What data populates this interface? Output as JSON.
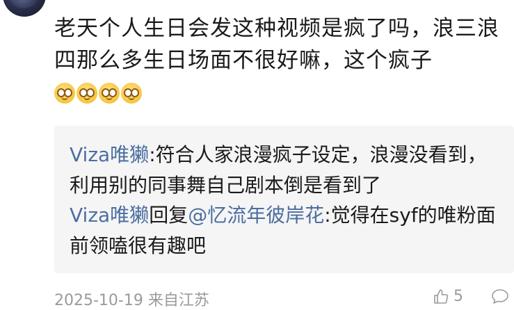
{
  "comment": {
    "line_text": "老天个人生日会发这种视频是疯了吗，浪三浪四那么多生日场面不很好嘛，这个疯子",
    "emoji_name": "clown-face-emoji",
    "emoji_count": 4
  },
  "replies": [
    {
      "author": "Viza唯獭",
      "separator": ":",
      "text": "符合人家浪漫疯子设定，浪漫没看到，利用别的同事舞自己剧本倒是看到了"
    },
    {
      "author": "Viza唯獭",
      "reply_word": "回复",
      "mention": "@忆流年彼岸花",
      "separator": ":",
      "text": "觉得在syf的唯粉面前领嗑很有趣吧"
    }
  ],
  "meta": {
    "date": "2025-10-19",
    "location": "来自江苏"
  },
  "actions": {
    "like_count": "5",
    "like_icon": "thumbs-up-icon",
    "comment_icon": "comment-bubble-icon"
  },
  "colors": {
    "link": "#4a6ea0",
    "meta_text": "#9a9a9a",
    "reply_bg": "#f5f5f5"
  }
}
